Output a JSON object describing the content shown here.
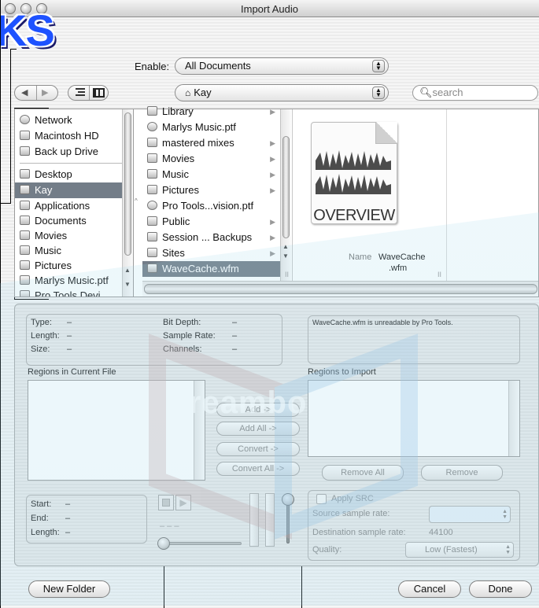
{
  "window": {
    "title": "Import Audio"
  },
  "watermark": {
    "corner_text": "KS",
    "center_text": "Dreambooks"
  },
  "enable": {
    "label": "Enable:",
    "value": "All Documents"
  },
  "location": {
    "value": "Kay"
  },
  "search": {
    "placeholder": "search"
  },
  "sidebar": {
    "items": [
      {
        "label": "Network",
        "icon": "globe-icon"
      },
      {
        "label": "Macintosh HD",
        "icon": "hard-drive-icon"
      },
      {
        "label": "Back up Drive",
        "icon": "drive-icon"
      },
      {
        "label": "Desktop",
        "icon": "desktop-icon"
      },
      {
        "label": "Kay",
        "icon": "home-icon",
        "selected": true
      },
      {
        "label": "Applications",
        "icon": "applications-icon"
      },
      {
        "label": "Documents",
        "icon": "document-icon"
      },
      {
        "label": "Movies",
        "icon": "movie-icon"
      },
      {
        "label": "Music",
        "icon": "music-icon"
      },
      {
        "label": "Pictures",
        "icon": "pictures-icon"
      },
      {
        "label": "Marlys Music.ptf",
        "icon": "session-icon"
      },
      {
        "label": "Pro Tools Devi...",
        "icon": "folder-icon"
      }
    ]
  },
  "files": {
    "items": [
      {
        "label": "Library",
        "folder": true
      },
      {
        "label": "Marlys Music.ptf",
        "folder": false
      },
      {
        "label": "mastered mixes",
        "folder": true
      },
      {
        "label": "Movies",
        "folder": true
      },
      {
        "label": "Music",
        "folder": true
      },
      {
        "label": "Pictures",
        "folder": true
      },
      {
        "label": "Pro Tools...vision.ptf",
        "folder": false
      },
      {
        "label": "Public",
        "folder": true
      },
      {
        "label": "Session ... Backups",
        "folder": true
      },
      {
        "label": "Sites",
        "folder": true
      },
      {
        "label": "WaveCache.wfm",
        "folder": false,
        "selected": true
      }
    ]
  },
  "preview": {
    "icon_text": "OVERVIEW",
    "name_label": "Name",
    "name_value_1": "WaveCache",
    "name_value_2": ".wfm"
  },
  "info": {
    "type_label": "Type:",
    "type_value": "–",
    "length_label": "Length:",
    "length_value": "–",
    "size_label": "Size:",
    "size_value": "–",
    "bitdepth_label": "Bit Depth:",
    "bitdepth_value": "–",
    "samplerate_label": "Sample Rate:",
    "samplerate_value": "–",
    "channels_label": "Channels:",
    "channels_value": "–",
    "message": "WaveCache.wfm is unreadable by Pro Tools."
  },
  "regions": {
    "current_label": "Regions in Current File",
    "import_label": "Regions to Import"
  },
  "buttons": {
    "add": "Add ->",
    "add_all": "Add All ->",
    "convert": "Convert ->",
    "convert_all": "Convert All ->",
    "remove_all": "Remove All",
    "remove": "Remove",
    "new_folder": "New Folder",
    "cancel": "Cancel",
    "done": "Done"
  },
  "playback": {
    "start_label": "Start:",
    "start_value": "–",
    "end_label": "End:",
    "end_value": "–",
    "length_label": "Length:",
    "length_value": "–",
    "counter": "– – –"
  },
  "src": {
    "apply_label": "Apply SRC",
    "source_label": "Source sample rate:",
    "dest_label": "Destination sample rate:",
    "dest_value": "44100",
    "quality_label": "Quality:",
    "quality_value": "Low (Fastest)"
  }
}
